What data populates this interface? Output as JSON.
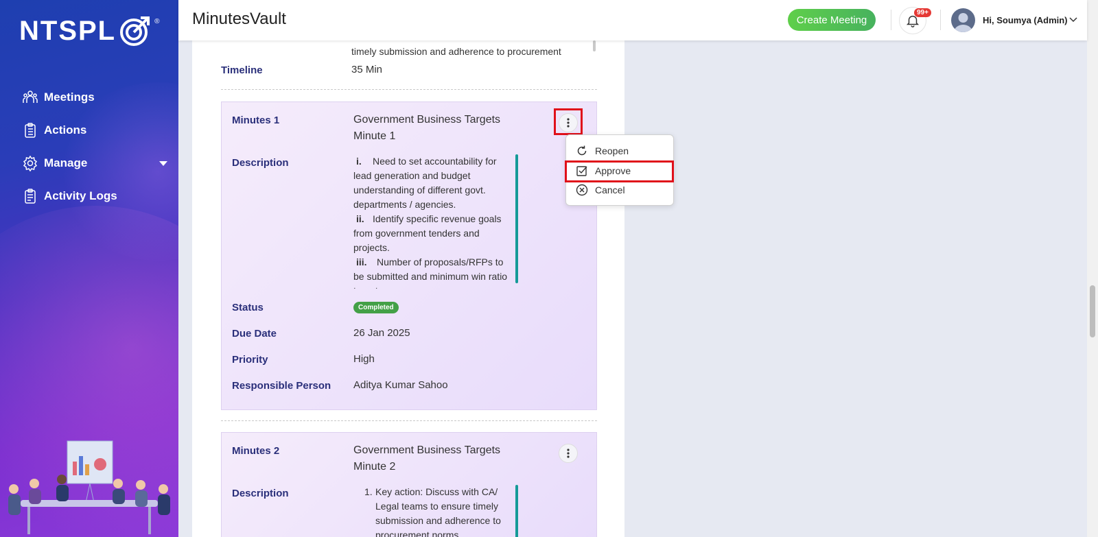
{
  "sidebar": {
    "logo_text": "NTSPL",
    "logo_reg": "®",
    "items": [
      {
        "label": "Meetings",
        "icon": "meetings-icon"
      },
      {
        "label": "Actions",
        "icon": "clipboard-icon"
      },
      {
        "label": "Manage",
        "icon": "gear-icon"
      },
      {
        "label": "Activity Logs",
        "icon": "logs-icon"
      }
    ]
  },
  "header": {
    "title": "MinutesVault",
    "create_meeting": "Create Meeting",
    "notification_count": "99+",
    "user_greeting": "Hi, Soumya (Admin)"
  },
  "top_section": {
    "partial_text": "timely submission and adherence to procurement",
    "timeline_label": "Timeline",
    "timeline_value": "35 Min"
  },
  "minutes": [
    {
      "label": "Minutes 1",
      "title_line1": "Government Business Targets",
      "title_line2": "Minute 1",
      "description_label": "Description",
      "description_items": [
        {
          "num": "i.",
          "text": "Need to set accountability for lead generation and budget understanding of different govt. departments / agencies."
        },
        {
          "num": "ii.",
          "text": "Identify specific revenue goals from government tenders and projects."
        },
        {
          "num": "iii.",
          "text": "Number of proposals/RFPs to be submitted and minimum win ratio targets."
        }
      ],
      "status_label": "Status",
      "status_value": "Completed",
      "due_date_label": "Due Date",
      "due_date_value": "26 Jan 2025",
      "priority_label": "Priority",
      "priority_value": "High",
      "responsible_label": "Responsible Person",
      "responsible_value": "Aditya Kumar Sahoo"
    },
    {
      "label": "Minutes 2",
      "title_line1": "Government Business Targets",
      "title_line2": "Minute 2",
      "description_label": "Description",
      "description_items": [
        {
          "num": "1.",
          "text": "Key action: Discuss with CA/ Legal teams to ensure timely submission and adherence to procurement norms."
        }
      ]
    }
  ],
  "context_menu": {
    "items": [
      {
        "label": "Reopen",
        "icon": "reopen-icon"
      },
      {
        "label": "Approve",
        "icon": "checkbox-icon"
      },
      {
        "label": "Cancel",
        "icon": "cancel-circle-icon"
      }
    ]
  },
  "colors": {
    "accent_label": "#2a2f7a",
    "status_completed": "#43a047",
    "create_button": "#5fcf4a",
    "highlight": "#e0101a"
  }
}
